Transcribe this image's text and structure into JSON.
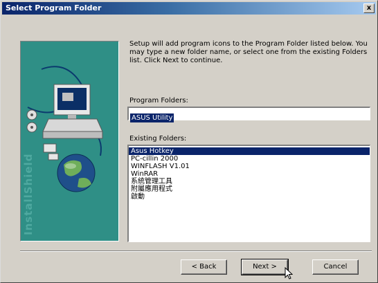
{
  "window": {
    "title": "Select Program Folder",
    "close_glyph": "x"
  },
  "description": "Setup will add program icons to the Program Folder listed below. You may type a new folder name, or select one from the existing Folders list. Click Next to continue.",
  "program_folders": {
    "label": "Program Folders:",
    "value": "ASUS Utility"
  },
  "existing_folders": {
    "label": "Existing Folders:",
    "items": [
      {
        "label": "Asus Hotkey",
        "selected": true
      },
      {
        "label": "PC-cillin 2000",
        "selected": false
      },
      {
        "label": "WINFLASH V1.01",
        "selected": false
      },
      {
        "label": "WinRAR",
        "selected": false
      },
      {
        "label": "系統管理工具",
        "selected": false
      },
      {
        "label": "附屬應用程式",
        "selected": false
      },
      {
        "label": "啟動",
        "selected": false
      }
    ]
  },
  "buttons": {
    "back": "< Back",
    "next": "Next >",
    "cancel": "Cancel"
  },
  "side_art": {
    "watermark": "InstallShield"
  },
  "colors": {
    "title_gradient_start": "#0a246a",
    "title_gradient_end": "#a6caf0",
    "dialog_face": "#d4d0c8",
    "art_background": "#2f8f86",
    "selection": "#0a246a"
  }
}
